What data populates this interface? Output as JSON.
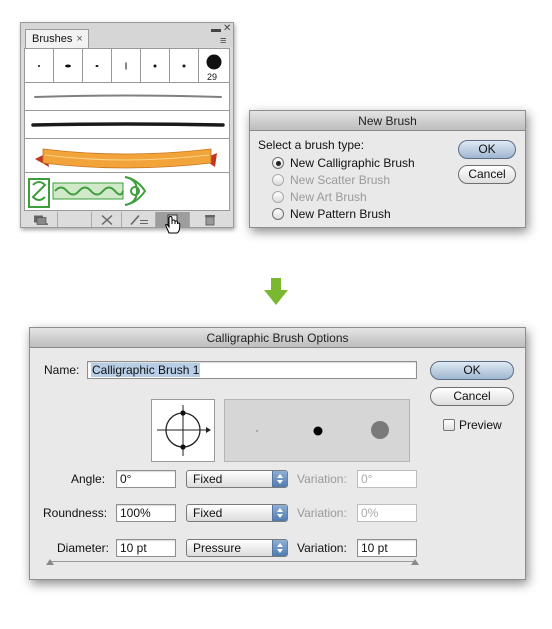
{
  "brushes_panel": {
    "tab_label": "Brushes",
    "tab_close": "×",
    "minimize": "▬",
    "close": "✕",
    "menu": "≡",
    "tip_count_label": "29"
  },
  "new_brush": {
    "title": "New Brush",
    "prompt": "Select a brush type:",
    "options": [
      {
        "label": "New Calligraphic Brush",
        "selected": true,
        "enabled": true
      },
      {
        "label": "New Scatter Brush",
        "selected": false,
        "enabled": false
      },
      {
        "label": "New Art Brush",
        "selected": false,
        "enabled": false
      },
      {
        "label": "New Pattern Brush",
        "selected": false,
        "enabled": true
      }
    ],
    "ok_label": "OK",
    "cancel_label": "Cancel"
  },
  "calligraphic": {
    "title": "Calligraphic Brush Options",
    "name_label": "Name:",
    "name_value": "Calligraphic Brush 1",
    "ok_label": "OK",
    "cancel_label": "Cancel",
    "preview_label": "Preview",
    "preview_checked": false,
    "variation_label": "Variation:",
    "rows": [
      {
        "label": "Angle:",
        "value": "0°",
        "mode": "Fixed",
        "variation": "0°"
      },
      {
        "label": "Roundness:",
        "value": "100%",
        "mode": "Fixed",
        "variation": "0%"
      },
      {
        "label": "Diameter:",
        "value": "10 pt",
        "mode": "Pressure",
        "variation": "10 pt"
      }
    ]
  },
  "colors": {
    "arrow": "#7cb82f",
    "ribbon": "#f2a33a",
    "pattern": "#3e9e3c",
    "dialog_bg": "#e9e9e9"
  }
}
